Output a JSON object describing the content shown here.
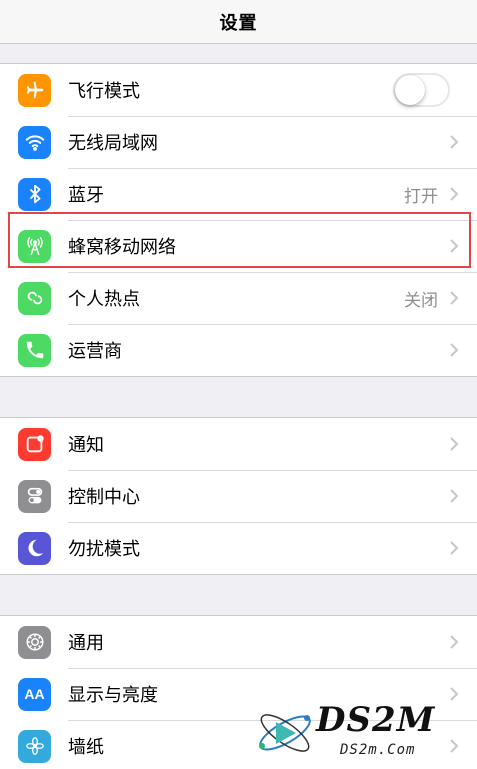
{
  "header": {
    "title": "设置"
  },
  "colors": {
    "airplane": "#ff9500",
    "wifi": "#1a82fb",
    "bluetooth": "#1a82fb",
    "cellular": "#4cd964",
    "hotspot": "#4cd964",
    "carrier": "#4cd964",
    "notifications": "#ff3b30",
    "control_center": "#8e8e93",
    "dnd": "#5856d6",
    "general": "#8e8e93",
    "display": "#1a82fb",
    "wallpaper": "#34aadc",
    "highlight_border": "#e0454c"
  },
  "groups": [
    {
      "items": [
        {
          "label": "飞行模式",
          "icon": "airplane-icon",
          "toggle": false
        },
        {
          "label": "无线局域网",
          "icon": "wifi-icon",
          "detail": ""
        },
        {
          "label": "蓝牙",
          "icon": "bluetooth-icon",
          "detail": "打开"
        },
        {
          "label": "蜂窝移动网络",
          "icon": "cellular-icon",
          "detail": ""
        },
        {
          "label": "个人热点",
          "icon": "hotspot-icon",
          "detail": "关闭"
        },
        {
          "label": "运营商",
          "icon": "phone-icon",
          "detail": ""
        }
      ]
    },
    {
      "items": [
        {
          "label": "通知",
          "icon": "notifications-icon"
        },
        {
          "label": "控制中心",
          "icon": "control-center-icon"
        },
        {
          "label": "勿扰模式",
          "icon": "moon-icon"
        }
      ]
    },
    {
      "items": [
        {
          "label": "通用",
          "icon": "gear-icon"
        },
        {
          "label": "显示与亮度",
          "icon": "display-brightness-icon",
          "icon_text": "AA"
        },
        {
          "label": "墙纸",
          "icon": "wallpaper-flower-icon"
        }
      ]
    }
  ],
  "watermark": {
    "brand": "DS2M",
    "url": "DS2m.Com"
  }
}
